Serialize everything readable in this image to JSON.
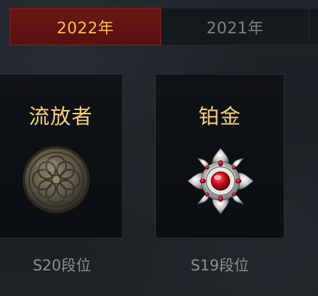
{
  "tabs": [
    {
      "label": "2022年",
      "active": true
    },
    {
      "label": "2021年",
      "active": false
    }
  ],
  "cards": [
    {
      "title": "流放者",
      "season": "S20段位",
      "icon": "exile-medal-icon"
    },
    {
      "title": "铂金",
      "season": "S19段位",
      "icon": "platinum-ruby-emblem-icon"
    }
  ],
  "colors": {
    "tab_active_bg": "#5a1010",
    "tab_active_text": "#f2c24f",
    "tab_inactive_text": "#7e8084",
    "card_title": "#f3cf84",
    "season_text": "#8c8f93"
  }
}
